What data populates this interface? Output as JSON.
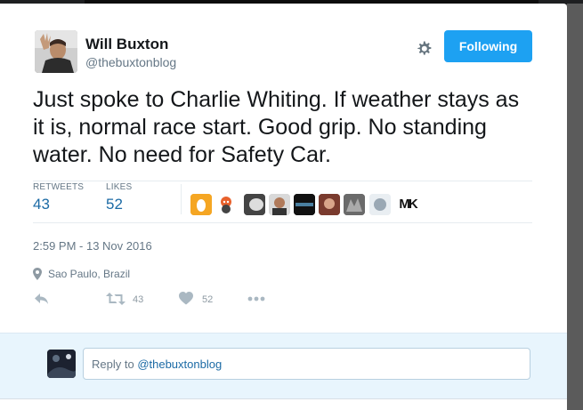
{
  "user": {
    "name": "Will Buxton",
    "handle": "@thebuxtonblog"
  },
  "header": {
    "follow_label": "Following"
  },
  "tweet": {
    "text": "Just spoke to Charlie Whiting. If weather stays as it is, normal race start. Good grip. No standing water. No need for Safety Car."
  },
  "stats": {
    "retweets_label": "RETWEETS",
    "retweets_count": "43",
    "likes_label": "LIKES",
    "likes_count": "52"
  },
  "likers": [
    "egg-avatar",
    "cartoon-avatar",
    "person-avatar",
    "person-avatar",
    "banner-avatar",
    "person-avatar",
    "cat-avatar",
    "person-avatar",
    "mk-logo-avatar"
  ],
  "mk_text": "MK",
  "meta": {
    "timestamp": "2:59 PM - 13 Nov 2016",
    "location": "Sao Paulo, Brazil"
  },
  "actions": {
    "retweet_count": "43",
    "like_count": "52"
  },
  "reply": {
    "prefix": "Reply to ",
    "mention": "@thebuxtonblog"
  },
  "colors": {
    "accent": "#1da1f2",
    "link": "#1b6aa5",
    "muted": "#657786"
  }
}
